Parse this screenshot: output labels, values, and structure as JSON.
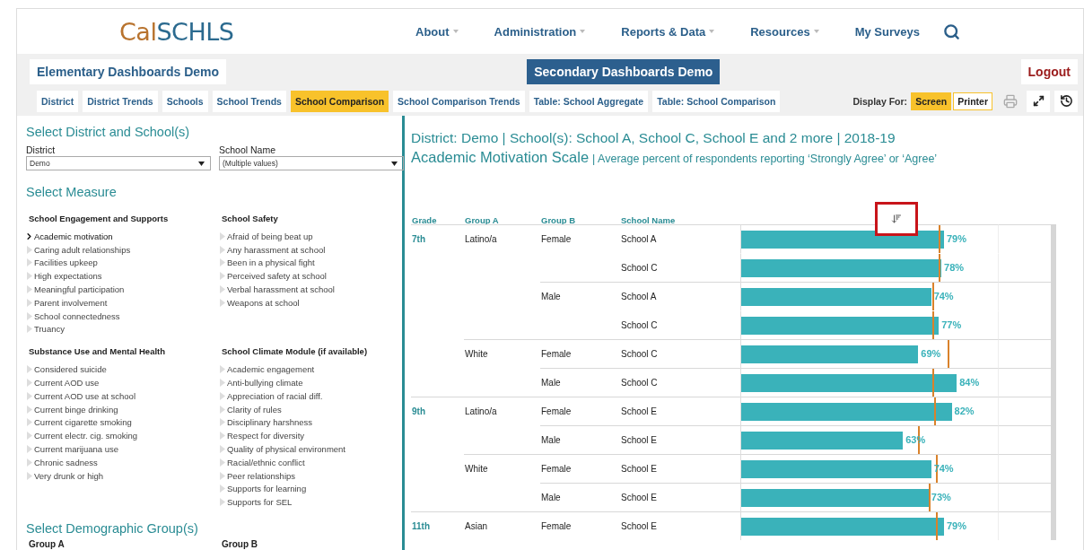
{
  "header": {
    "logo": {
      "prefix": "Cal",
      "suffix": "SCHLS"
    },
    "nav": [
      {
        "label": "About",
        "has_menu": true
      },
      {
        "label": "Administration",
        "has_menu": true
      },
      {
        "label": "Reports & Data",
        "has_menu": true
      },
      {
        "label": "Resources",
        "has_menu": true
      },
      {
        "label": "My Surveys",
        "has_menu": false
      }
    ]
  },
  "dashboards": [
    {
      "label": "Elementary Dashboards Demo",
      "selected": false
    },
    {
      "label": "Secondary Dashboards Demo",
      "selected": true
    }
  ],
  "logout": "Logout",
  "tabs": [
    {
      "label": "District",
      "selected": false
    },
    {
      "label": "District Trends",
      "selected": false
    },
    {
      "label": "Schools",
      "selected": false
    },
    {
      "label": "School Trends",
      "selected": false
    },
    {
      "label": "School Comparison",
      "selected": true
    },
    {
      "label": "School Comparison Trends",
      "selected": false
    },
    {
      "label": "Table: School Aggregate",
      "selected": false
    },
    {
      "label": "Table: School Comparison",
      "selected": false
    }
  ],
  "display_for": {
    "label": "Display For:",
    "options": [
      {
        "label": "Screen",
        "selected": true
      },
      {
        "label": "Printer",
        "selected": false
      }
    ]
  },
  "filters": {
    "title": "Select District and School(s)",
    "fields": [
      {
        "label": "District",
        "value": "Demo"
      },
      {
        "label": "School Name",
        "value": "(Multiple values)"
      }
    ]
  },
  "measure": {
    "title": "Select Measure",
    "groups": [
      {
        "title": "School Engagement and Supports",
        "items": [
          {
            "label": "Academic motivation",
            "selected": true
          },
          {
            "label": "Caring adult relationships",
            "selected": false
          },
          {
            "label": "Facilities upkeep",
            "selected": false
          },
          {
            "label": "High expectations",
            "selected": false
          },
          {
            "label": "Meaningful participation",
            "selected": false
          },
          {
            "label": "Parent involvement",
            "selected": false
          },
          {
            "label": "School connectedness",
            "selected": false
          },
          {
            "label": "Truancy",
            "selected": false
          }
        ]
      },
      {
        "title": "School Safety",
        "items": [
          {
            "label": "Afraid of being beat up",
            "selected": false
          },
          {
            "label": "Any harassment at school",
            "selected": false
          },
          {
            "label": "Been in a physical fight",
            "selected": false
          },
          {
            "label": "Perceived safety at school",
            "selected": false
          },
          {
            "label": "Verbal harassment at school",
            "selected": false
          },
          {
            "label": "Weapons at school",
            "selected": false
          }
        ]
      },
      {
        "title": "Substance Use and Mental Health",
        "items": [
          {
            "label": "Considered suicide",
            "selected": false
          },
          {
            "label": "Current AOD use",
            "selected": false
          },
          {
            "label": "Current AOD use at school",
            "selected": false
          },
          {
            "label": "Current binge drinking",
            "selected": false
          },
          {
            "label": "Current cigarette smoking",
            "selected": false
          },
          {
            "label": "Current electr. cig. smoking",
            "selected": false
          },
          {
            "label": "Current marijuana use",
            "selected": false
          },
          {
            "label": "Chronic sadness",
            "selected": false
          },
          {
            "label": "Very drunk or high",
            "selected": false
          }
        ]
      },
      {
        "title": "School Climate Module (if available)",
        "items": [
          {
            "label": "Academic engagement",
            "selected": false
          },
          {
            "label": "Anti-bullying climate",
            "selected": false
          },
          {
            "label": "Appreciation of racial diff.",
            "selected": false
          },
          {
            "label": "Clarity of rules",
            "selected": false
          },
          {
            "label": "Disciplinary harshness",
            "selected": false
          },
          {
            "label": "Respect for diversity",
            "selected": false
          },
          {
            "label": "Quality of physical environment",
            "selected": false
          },
          {
            "label": "Racial/ethnic conflict",
            "selected": false
          },
          {
            "label": "Peer relationships",
            "selected": false
          },
          {
            "label": "Supports for learning",
            "selected": false
          },
          {
            "label": "Supports for SEL",
            "selected": false
          }
        ]
      }
    ]
  },
  "demographics": {
    "title": "Select Demographic Group(s)",
    "groups": [
      "Group A",
      "Group B"
    ]
  },
  "report": {
    "title": "District: Demo | School(s): School A, School C, School E and 2 more | 2018-19",
    "measure": "Academic Motivation Scale",
    "description": "| Average percent of respondents reporting ‘Strongly Agree’ or ‘Agree’",
    "columns": [
      "Grade",
      "Group A",
      "Group B",
      "School Name"
    ],
    "rows": [
      {
        "grade": "7th",
        "group_a": "Latino/a",
        "group_b": "Female",
        "school": "School A",
        "value": "79%",
        "bar": {
          "level": 0.79
        },
        "reference": {
          "level": 0.77
        }
      },
      {
        "school": "School C",
        "value": "78%",
        "bar": {
          "level": 0.78
        },
        "reference": {
          "level": 0.77
        }
      },
      {
        "group_b": "Male",
        "school": "School A",
        "value": "74%",
        "bar": {
          "level": 0.74
        },
        "reference": {
          "level": 0.745
        }
      },
      {
        "school": "School C",
        "value": "77%",
        "bar": {
          "level": 0.77
        },
        "reference": {
          "level": 0.745
        }
      },
      {
        "group_a": "White",
        "group_b": "Female",
        "school": "School C",
        "value": "69%",
        "bar": {
          "level": 0.69
        },
        "reference": {
          "level": 0.805
        }
      },
      {
        "group_b": "Male",
        "school": "School C",
        "value": "84%",
        "bar": {
          "level": 0.84
        },
        "reference": {
          "level": 0.745
        }
      },
      {
        "grade": "9th",
        "group_a": "Latino/a",
        "group_b": "Female",
        "school": "School E",
        "value": "82%",
        "bar": {
          "level": 0.82
        },
        "reference": {
          "level": 0.75
        }
      },
      {
        "group_b": "Male",
        "school": "School E",
        "value": "63%",
        "bar": {
          "level": 0.63
        },
        "reference": {
          "level": 0.69
        }
      },
      {
        "group_a": "White",
        "group_b": "Female",
        "school": "School E",
        "value": "74%",
        "bar": {
          "level": 0.74
        },
        "reference": {
          "level": 0.76
        }
      },
      {
        "group_b": "Male",
        "school": "School E",
        "value": "73%",
        "bar": {
          "level": 0.73
        },
        "reference": {
          "level": 0.73
        }
      },
      {
        "grade": "11th",
        "group_a": "Asian",
        "group_b": "Female",
        "school": "School E",
        "value": "79%",
        "bar": {
          "level": 0.79
        },
        "reference": {
          "level": 0.76
        }
      }
    ]
  }
}
